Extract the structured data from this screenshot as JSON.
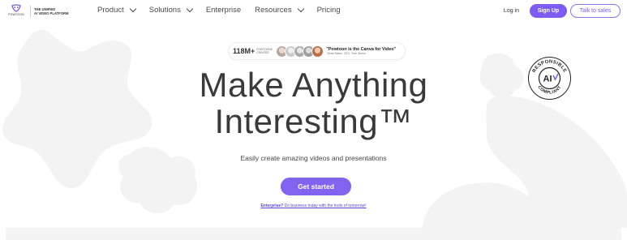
{
  "logo": {
    "wordmark": "POWTOON",
    "tagline_line1": "THE UNIFIED",
    "tagline_line2": "AI VIDEO PLATFORM"
  },
  "nav": {
    "items": [
      {
        "label": "Product",
        "has_dropdown": true
      },
      {
        "label": "Solutions",
        "has_dropdown": true
      },
      {
        "label": "Enterprise",
        "has_dropdown": false
      },
      {
        "label": "Resources",
        "has_dropdown": true
      },
      {
        "label": "Pricing",
        "has_dropdown": false
      }
    ],
    "login_label": "Log in",
    "signup_label": "Sign Up",
    "talk_label": "Talk to sales"
  },
  "social_proof": {
    "count": "118M+",
    "count_caption": "POWTOONS CREATED",
    "quote": "\"Powtoon is the Canva for Video\"",
    "quote_author": "Stuart Baker, CEO, Tech Senior"
  },
  "hero": {
    "headline_line1": "Make Anything",
    "headline_line2": "Interesting™",
    "subtitle": "Easily create amazing videos and presentations",
    "cta_label": "Get started",
    "enterprise_strong": "Enterprise?",
    "enterprise_text": " Do business today with the tools of tomorrow!"
  },
  "badge": {
    "top_text": "RESPONSIBLE",
    "center_text": "AI",
    "bottom_text": "COMPLIANT"
  },
  "colors": {
    "accent": "#7c5cf3",
    "blob": "#f3f3f3",
    "text": "#3a3a3a"
  }
}
